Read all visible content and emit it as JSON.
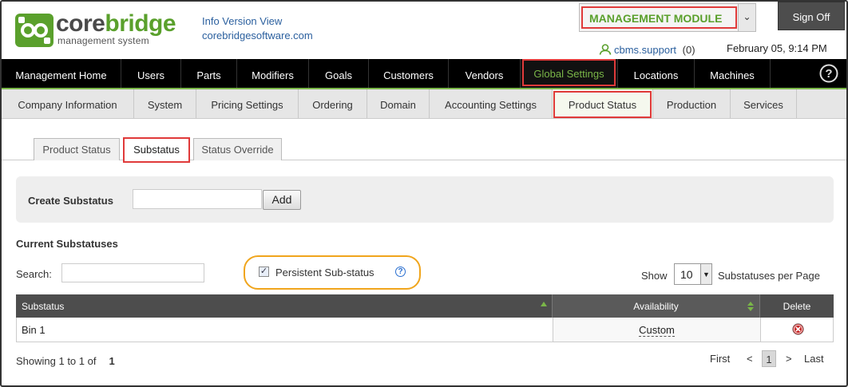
{
  "brand": {
    "name_part1": "core",
    "name_part2": "bridge",
    "subtitle": "management system"
  },
  "header": {
    "info_link_1": "Info Version View",
    "info_link_2": "corebridgesoftware.com",
    "module_select": "MANAGEMENT MODULE",
    "sign_off": "Sign Off",
    "username": "cbms.support",
    "notification_count": "(0)",
    "datetime": "February 05, 9:14 PM"
  },
  "main_nav": [
    {
      "label": "Management Home"
    },
    {
      "label": "Users"
    },
    {
      "label": "Parts"
    },
    {
      "label": "Modifiers"
    },
    {
      "label": "Goals"
    },
    {
      "label": "Customers"
    },
    {
      "label": "Vendors"
    },
    {
      "label": "Global Settings",
      "active": true
    },
    {
      "label": "Locations"
    },
    {
      "label": "Machines"
    }
  ],
  "sub_nav": [
    {
      "label": "Company Information"
    },
    {
      "label": "System"
    },
    {
      "label": "Pricing Settings"
    },
    {
      "label": "Ordering"
    },
    {
      "label": "Domain"
    },
    {
      "label": "Accounting Settings"
    },
    {
      "label": "Product Status",
      "active": true
    },
    {
      "label": "Production"
    },
    {
      "label": "Services"
    }
  ],
  "tabs": [
    {
      "label": "Product Status"
    },
    {
      "label": "Substatus",
      "active": true
    },
    {
      "label": "Status Override"
    }
  ],
  "create": {
    "label": "Create Substatus",
    "input_value": "",
    "add_button": "Add"
  },
  "list": {
    "title": "Current Substatuses",
    "search_label": "Search:",
    "search_value": "",
    "persistent_label": "Persistent Sub-status",
    "persistent_checked": true,
    "show_label": "Show",
    "page_size": "10",
    "per_page_label": "Substatuses per Page",
    "columns": [
      "Substatus",
      "Availability",
      "Delete"
    ],
    "rows": [
      {
        "substatus": "Bin 1",
        "availability": "Custom"
      }
    ],
    "showing_text": "Showing 1 to 1 of",
    "total": "1"
  },
  "pager": {
    "first": "First",
    "prev": "<",
    "current": "1",
    "next": ">",
    "last": "Last"
  },
  "colors": {
    "brand_green": "#5aa02c",
    "nav_bg": "#000000",
    "highlight_red": "#e03a3a",
    "callout_orange": "#f0a51c"
  }
}
